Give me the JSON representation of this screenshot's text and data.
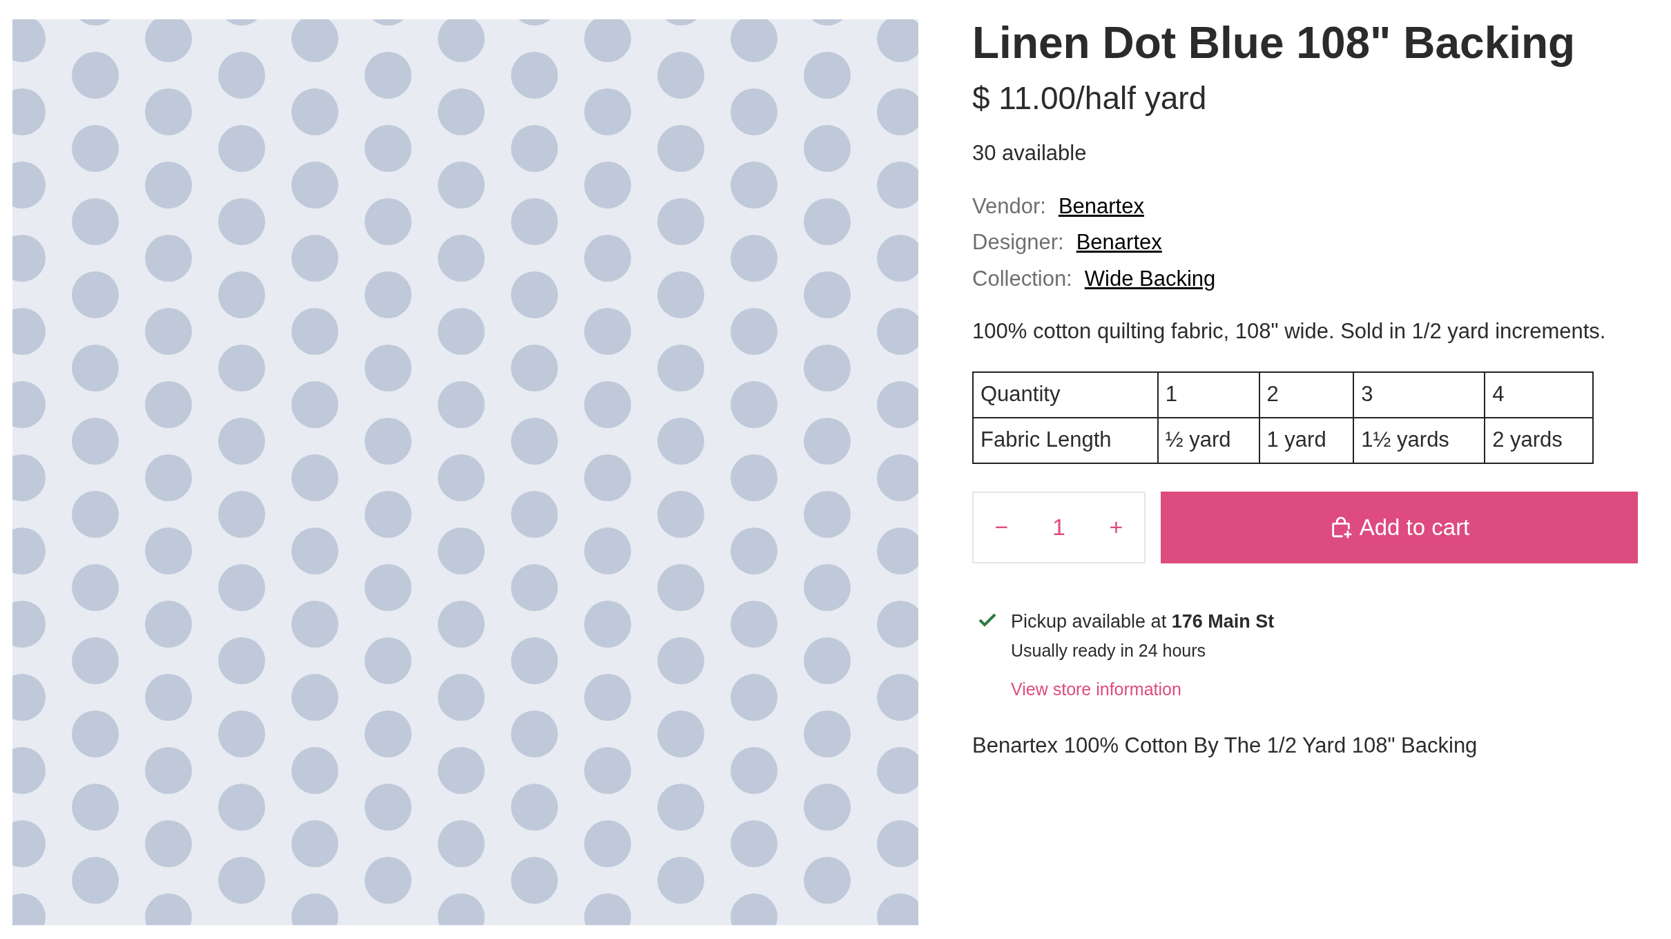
{
  "product": {
    "title": "Linen Dot Blue 108\" Backing",
    "price": "$ 11.00/half yard",
    "availability": "30 available",
    "meta": [
      {
        "label": "Vendor:",
        "value": "Benartex"
      },
      {
        "label": "Designer:",
        "value": "Benartex"
      },
      {
        "label": "Collection:",
        "value": "Wide Backing"
      }
    ],
    "summary": "100% cotton quilting fabric, 108\" wide. Sold in 1/2 yard increments."
  },
  "table": {
    "rows": [
      [
        "Quantity",
        "1",
        "2",
        "3",
        "4"
      ],
      [
        "Fabric Length",
        "½ yard",
        "1 yard",
        "1½ yards",
        "2 yards"
      ]
    ]
  },
  "quantity": {
    "decrease": "−",
    "value": "1",
    "increase": "+"
  },
  "add_to_cart": "Add to cart",
  "pickup": {
    "available": true,
    "text": "Pickup available at **176 Main St**",
    "note": "Usually ready in 24 hours",
    "link": "View store information"
  },
  "description": "Benartex 100% Cotton By The 1/2 Yard 108\" Backing"
}
